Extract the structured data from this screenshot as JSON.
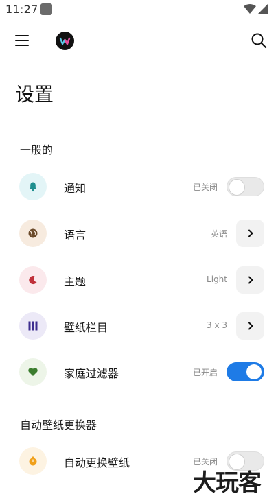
{
  "status_bar": {
    "time": "11:27"
  },
  "header": {
    "title": "设置"
  },
  "sections": {
    "general": {
      "title": "一般的"
    },
    "wallpaper_changer": {
      "title": "自动壁纸更换器"
    }
  },
  "rows": {
    "notifications": {
      "label": "通知",
      "value": "已关闭",
      "toggle": "off",
      "icon": "bell-icon",
      "icon_bg": "#e3f5f7",
      "icon_color": "#1f8f8f"
    },
    "language": {
      "label": "语言",
      "value": "英语",
      "icon": "globe-icon",
      "icon_bg": "#f7ebdf",
      "icon_color": "#6b4a2a"
    },
    "theme": {
      "label": "主题",
      "value": "Light",
      "icon": "moon-icon",
      "icon_bg": "#fbe9ec",
      "icon_color": "#c0303a"
    },
    "wallpaper_columns": {
      "label": "壁纸栏目",
      "value": "3 x 3",
      "icon": "columns-icon",
      "icon_bg": "#ece9f7",
      "icon_color": "#3d2d8f"
    },
    "family_filter": {
      "label": "家庭过滤器",
      "value": "已开启",
      "toggle": "on",
      "icon": "heart-icon",
      "icon_bg": "#edf5e8",
      "icon_color": "#3b7d2e"
    },
    "auto_change": {
      "label": "自动更换壁纸",
      "value": "已关闭",
      "toggle": "off",
      "icon": "timer-icon",
      "icon_bg": "#fdf3e2",
      "icon_color": "#f0a01a"
    }
  },
  "watermark": {
    "text": "大玩客"
  },
  "colors": {
    "accent": "#1e7be6",
    "chevron_button_bg": "#f2f2f2"
  }
}
